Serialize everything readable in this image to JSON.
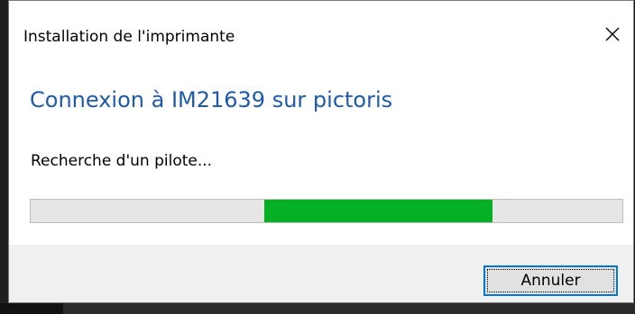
{
  "window": {
    "title": "Installation de l'imprimante",
    "close_icon": "close-icon"
  },
  "main": {
    "heading": "Connexion à IM21639 sur pictoris",
    "status": "Recherche d'un pilote...",
    "progress": {
      "style": "marquee",
      "segment_start": 0.395,
      "segment_end": 0.78,
      "color": "#06b025"
    }
  },
  "footer": {
    "cancel_label": "Annuler"
  },
  "colors": {
    "heading": "#1e5aa8",
    "accent_border": "#0078d7",
    "footer_bg": "#f0f0f0"
  }
}
